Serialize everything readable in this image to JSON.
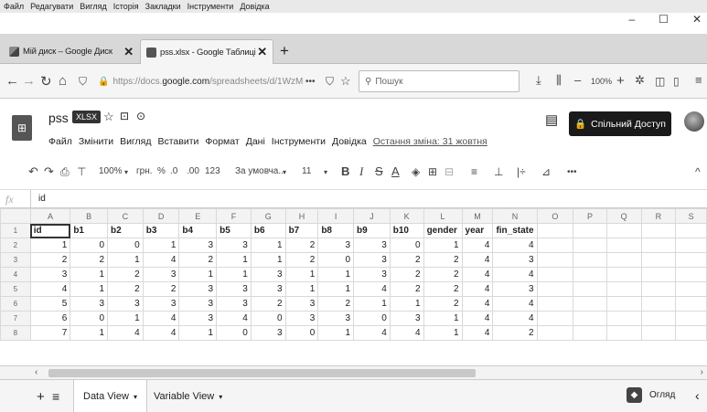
{
  "menubar": [
    "Файл",
    "Редагувати",
    "Вигляд",
    "Історія",
    "Закладки",
    "Інструменти",
    "Довідка"
  ],
  "window_controls": {
    "minimize": "–",
    "maximize": "☐",
    "close": "✕"
  },
  "tabs": [
    {
      "title": "Мій диск – Google Диск",
      "close": "✕"
    },
    {
      "title": "pss.xlsx - Google Таблиці",
      "close": "✕"
    }
  ],
  "new_tab": "+",
  "nav": {
    "url_prefix": "https://docs.",
    "url_domain": "google.com",
    "url_rest": "/spreadsheets/d/1WzM",
    "more": "•••",
    "search_placeholder": "Пошук",
    "zoom": "100%"
  },
  "doc": {
    "title": "pss",
    "badge": "XLSX",
    "menu": [
      "Файл",
      "Змінити",
      "Вигляд",
      "Вставити",
      "Формат",
      "Дані",
      "Інструменти",
      "Довідка"
    ],
    "last_change": "Остання зміна: 31 жовтня",
    "share": "Спільний Доступ"
  },
  "toolbar": {
    "zoom": "100%",
    "currency": "грн.",
    "percent": "%",
    "dec_less": ".0",
    "dec_more": ".00",
    "format": "123",
    "font": "За умовча...",
    "size": "11",
    "bold": "B",
    "italic": "I",
    "strike": "S",
    "textcolor": "A",
    "more": "•••"
  },
  "formula_bar": {
    "fx": "fx",
    "value": "id"
  },
  "grid": {
    "columns": [
      "A",
      "B",
      "C",
      "D",
      "E",
      "F",
      "G",
      "H",
      "I",
      "J",
      "K",
      "L",
      "M",
      "N",
      "O",
      "P",
      "Q",
      "R",
      "S"
    ],
    "row_numbers": [
      "1",
      "2",
      "3",
      "4",
      "5",
      "6",
      "7",
      "8"
    ],
    "header": [
      "id",
      "b1",
      "b2",
      "b3",
      "b4",
      "b5",
      "b6",
      "b7",
      "b8",
      "b9",
      "b10",
      "gender",
      "year",
      "fin_state"
    ],
    "rows": [
      [
        "1",
        "0",
        "0",
        "1",
        "3",
        "3",
        "1",
        "2",
        "3",
        "3",
        "0",
        "1",
        "4",
        "4"
      ],
      [
        "2",
        "2",
        "1",
        "4",
        "2",
        "1",
        "1",
        "2",
        "0",
        "3",
        "2",
        "2",
        "4",
        "3"
      ],
      [
        "3",
        "1",
        "2",
        "3",
        "1",
        "1",
        "3",
        "1",
        "1",
        "3",
        "2",
        "2",
        "4",
        "4"
      ],
      [
        "4",
        "1",
        "2",
        "2",
        "3",
        "3",
        "3",
        "1",
        "1",
        "4",
        "2",
        "2",
        "4",
        "3"
      ],
      [
        "5",
        "3",
        "3",
        "3",
        "3",
        "3",
        "2",
        "3",
        "2",
        "1",
        "1",
        "2",
        "4",
        "4"
      ],
      [
        "6",
        "0",
        "1",
        "4",
        "3",
        "4",
        "0",
        "3",
        "3",
        "0",
        "3",
        "1",
        "4",
        "4"
      ],
      [
        "7",
        "1",
        "4",
        "4",
        "1",
        "0",
        "3",
        "0",
        "1",
        "4",
        "4",
        "1",
        "4",
        "2"
      ]
    ]
  },
  "sheets": [
    {
      "label": "Data View",
      "arrow": "▾"
    },
    {
      "label": "Variable View",
      "arrow": "▾"
    }
  ],
  "sheet_controls": {
    "add": "+",
    "all": "≡"
  },
  "explore": "Огляд"
}
